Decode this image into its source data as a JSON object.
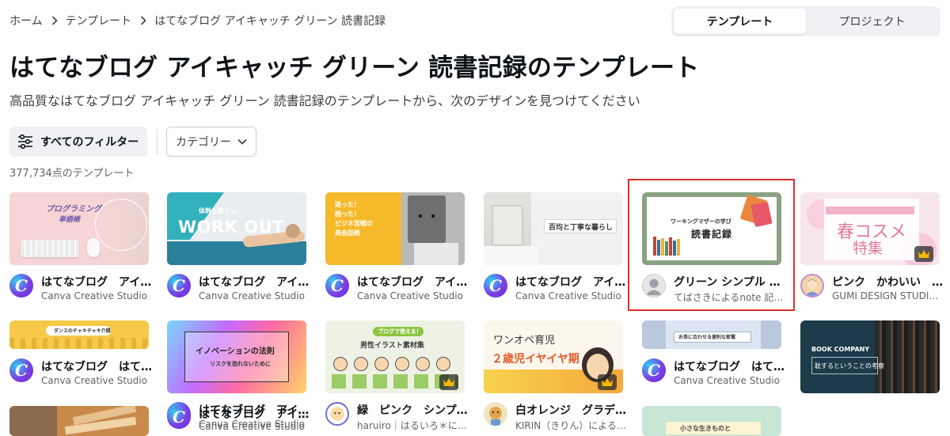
{
  "breadcrumb": [
    "ホーム",
    "テンプレート",
    "はてなブログ アイキャッチ グリーン 読書記録"
  ],
  "tabs": [
    "テンプレート",
    "プロジェクト"
  ],
  "page": {
    "title": "はてなブログ アイキャッチ グリーン 読書記録のテンプレート",
    "subtitle": "高品質なはてなブログ アイキャッチ グリーン 読書記録のテンプレートから、次のデザインを見つけてください"
  },
  "filters": {
    "all": "すべてのフィルター",
    "category": "カテゴリー"
  },
  "count": "377,734点のテンプレート",
  "colors": {
    "highlight": "#e02b2b",
    "canva_purple": "#7b3fe4",
    "canva_cyan": "#2ed0f0"
  },
  "cards": [
    {
      "title": "はてなブログ　アイ…",
      "author": "Canva Creative Studio",
      "thumb_text": [
        "プログラミング",
        "単語帳"
      ]
    },
    {
      "title": "はてなブログ　アイ…",
      "author": "Canva Creative Studio",
      "thumb_text": [
        "体幹と筋トレ",
        "WORK OUT"
      ]
    },
    {
      "title": "はてなブログ　アイ…",
      "author": "Canva Creative Studio",
      "thumb_text": [
        "迷った！",
        "困った！",
        "ビジネ苦戦の",
        "英会話術"
      ]
    },
    {
      "title": "はてなブログ　アイ…",
      "author": "Canva Creative Studio",
      "thumb_text": [
        "百均と丁寧な暮らし"
      ]
    },
    {
      "title": "グリーン シンプル …",
      "author": "てばさきによるnote 記…",
      "thumb_text": [
        "ワーキングマザーの学び",
        "読書記録"
      ]
    },
    {
      "title": "ピンク　かわいい　…",
      "author": "GUMI DESIGN STUDIO…",
      "thumb_text": [
        "春コスメ",
        "特集"
      ]
    },
    {
      "title": "はてなブログ　はて…",
      "author": "Canva Creative Studio",
      "thumb_text": [
        "ダンスのチャキチャキ介錯"
      ]
    },
    {
      "title": "はてなブログ　アイ…",
      "author": "Canva Creative Studio",
      "thumb_text": [
        "イノベーションの法則",
        "リスクを恐れないために"
      ]
    },
    {
      "title": "緑　ピンク　シンプ…",
      "author": "haruiro｜はるいろ＊に…",
      "thumb_text": [
        "ブログで使える！",
        "男性イラスト素材集"
      ]
    },
    {
      "title": "白オレンジ　グラデ…",
      "author": "KIRIN（きりん）による…",
      "thumb_text": [
        "ワンオペ育児",
        "２歳児イヤイヤ期"
      ]
    },
    {
      "title": "はてなブログ　はて…",
      "author": "Canva Creative Studio",
      "thumb_text": [
        "お茶に合わせる便利な家電"
      ]
    },
    {
      "title": "はてなブログ　アイ…",
      "author": "Canva Creative Studio",
      "thumb_text": [
        "BOOK COMPANY",
        "耽するということの考察"
      ]
    },
    {
      "title": "はてなブログ　アイ…",
      "author": "Canva Creative Studio",
      "thumb_text": [
        "小さな生きものと"
      ]
    }
  ]
}
